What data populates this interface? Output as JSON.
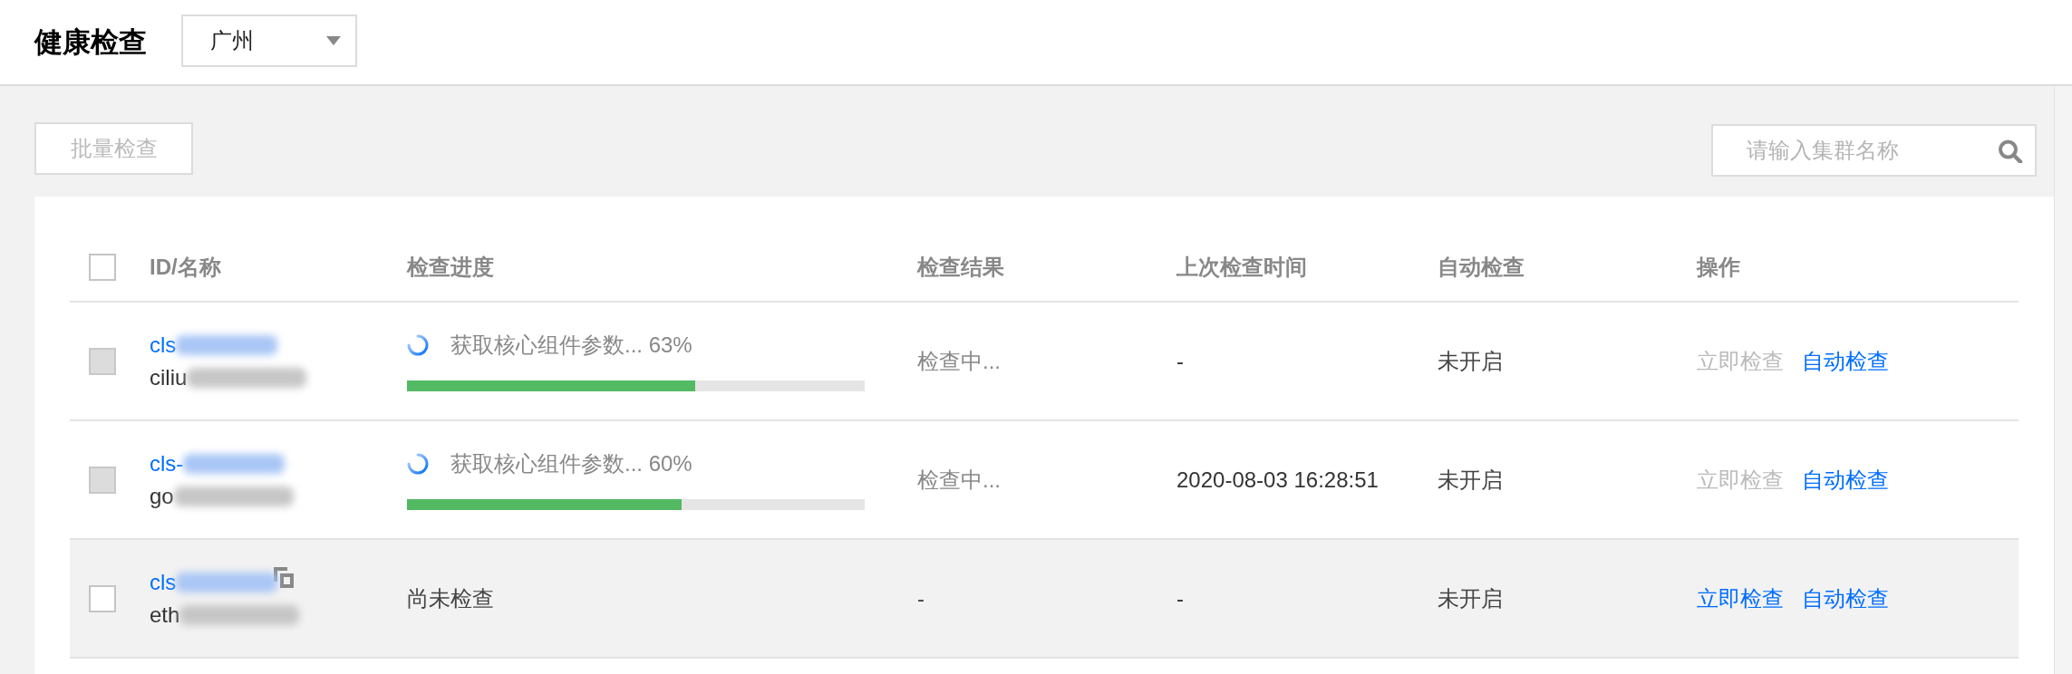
{
  "header": {
    "title": "健康检查",
    "region_select": {
      "value": "广州"
    }
  },
  "toolbar": {
    "batch_button": {
      "label": "批量检查",
      "disabled": true
    },
    "search": {
      "placeholder": "请输入集群名称"
    }
  },
  "table": {
    "select_all": {
      "checked": false
    },
    "columns": [
      "ID/名称",
      "检查进度",
      "检查结果",
      "上次检查时间",
      "自动检查",
      "操作"
    ],
    "rows": [
      {
        "selected": false,
        "checkbox_disabled": true,
        "highlighted": false,
        "id": "cls",
        "id_redacted": true,
        "name": "ciliu",
        "name_redacted": true,
        "copy_icon": false,
        "progress": {
          "kind": "running",
          "text": "获取核心组件参数... 63%",
          "level": 0.63
        },
        "result": {
          "text": "检查中...",
          "pending": true
        },
        "last_check": "-",
        "auto_check": "未开启",
        "actions": [
          {
            "label": "立即检查",
            "disabled": true
          },
          {
            "label": "自动检查",
            "disabled": false
          }
        ]
      },
      {
        "selected": false,
        "checkbox_disabled": true,
        "highlighted": false,
        "id": "cls-",
        "id_redacted": true,
        "name": "go",
        "name_redacted": true,
        "copy_icon": false,
        "progress": {
          "kind": "running",
          "text": "获取核心组件参数... 60%",
          "level": 0.6
        },
        "result": {
          "text": "检查中...",
          "pending": true
        },
        "last_check": "2020-08-03 16:28:51",
        "auto_check": "未开启",
        "actions": [
          {
            "label": "立即检查",
            "disabled": true
          },
          {
            "label": "自动检查",
            "disabled": false
          }
        ]
      },
      {
        "selected": false,
        "checkbox_disabled": false,
        "highlighted": true,
        "id": "cls",
        "id_redacted": true,
        "name": "eth",
        "name_redacted": true,
        "copy_icon": true,
        "progress": {
          "kind": "text",
          "text": "尚未检查"
        },
        "result": {
          "text": "-",
          "pending": false
        },
        "last_check": "-",
        "auto_check": "未开启",
        "actions": [
          {
            "label": "立即检查",
            "disabled": false
          },
          {
            "label": "自动检查",
            "disabled": false
          }
        ]
      }
    ]
  }
}
